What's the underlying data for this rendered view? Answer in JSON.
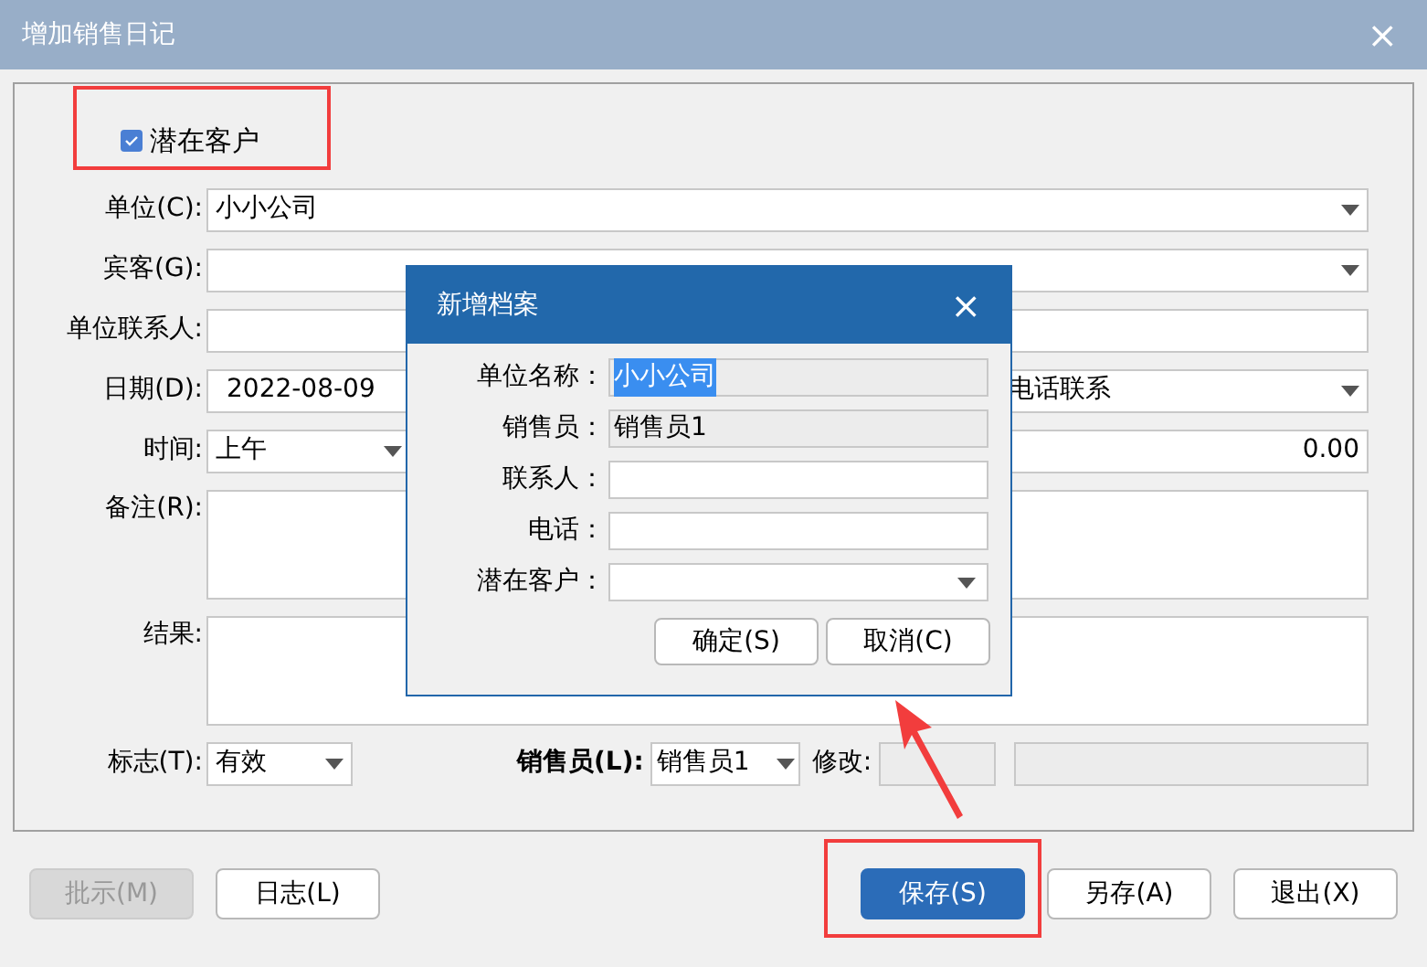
{
  "window": {
    "title": "增加销售日记",
    "close": "×"
  },
  "potential_customer": {
    "label": "潜在客户",
    "checked": true
  },
  "rows": [
    {
      "label": "单位(C):",
      "controls": [
        {
          "kind": "combo",
          "value": "小小公司"
        }
      ]
    },
    {
      "label": "宾客(G):",
      "controls": [
        {
          "kind": "combo"
        }
      ]
    },
    {
      "label": "单位联系人:",
      "controls": [
        {
          "kind": "text"
        }
      ]
    },
    {
      "label": "日期(D):",
      "controls": [
        {
          "kind": "text",
          "value": "2022-08-09"
        },
        {
          "kind": "combo",
          "value": "电话联系"
        }
      ]
    },
    {
      "label": "时间:",
      "controls": [
        {
          "kind": "combo",
          "value": "上午"
        },
        {
          "kind": "number",
          "value": "0.00"
        }
      ]
    },
    {
      "label": "备注(R):",
      "controls": [
        {
          "kind": "textarea"
        }
      ]
    },
    {
      "label": "结果:",
      "controls": [
        {
          "kind": "textarea"
        }
      ]
    }
  ],
  "footer_row": {
    "flag_label": "标志(T):",
    "flag_value": "有效",
    "salesperson_label": "销售员(L):",
    "salesperson_value": "销售员1",
    "modified_label": "修改:"
  },
  "buttons": [
    {
      "label": "批示(M)",
      "disabled": true,
      "default": false
    },
    {
      "label": "日志(L)",
      "disabled": false,
      "default": false
    },
    {
      "label": "保存(S)",
      "disabled": false,
      "default": true
    },
    {
      "label": "另存(A)",
      "disabled": false,
      "default": false
    },
    {
      "label": "退出(X)",
      "disabled": false,
      "default": false
    }
  ],
  "dialog": {
    "title": "新增档案",
    "close": "×",
    "fields": [
      {
        "label": "单位名称：",
        "kind": "text",
        "value": "小小公司",
        "readonly": true,
        "highlighted": true
      },
      {
        "label": "销售员：",
        "kind": "text",
        "value": "销售员1",
        "readonly": true,
        "highlighted": false
      },
      {
        "label": "联系人：",
        "kind": "text",
        "readonly": false
      },
      {
        "label": "电话：",
        "kind": "text",
        "readonly": false
      },
      {
        "label": "潜在客户：",
        "kind": "combo",
        "readonly": false
      }
    ],
    "buttons": [
      "确定(S)",
      "取消(C)"
    ]
  }
}
